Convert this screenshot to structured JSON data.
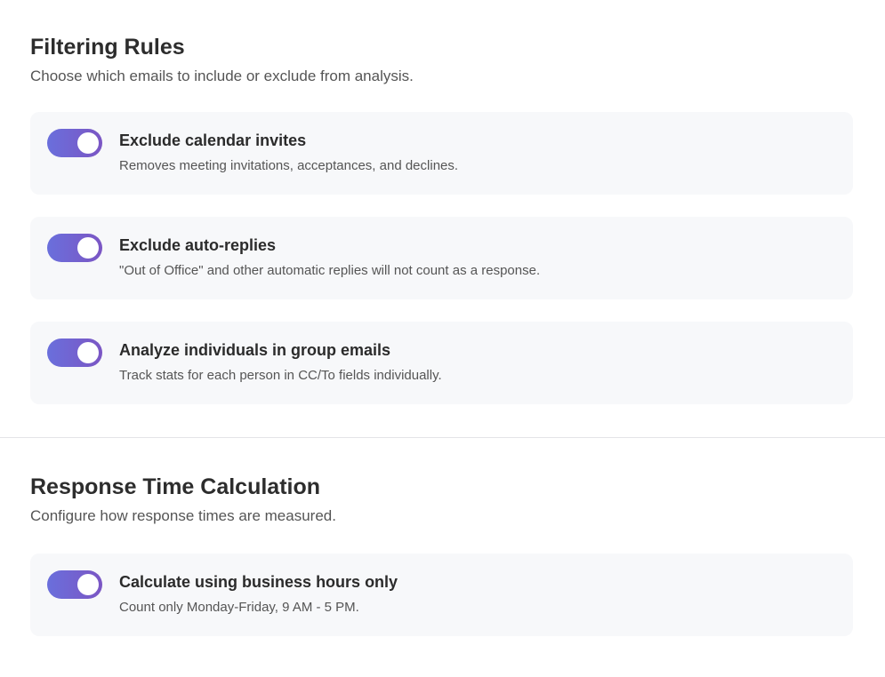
{
  "filtering": {
    "title": "Filtering Rules",
    "description": "Choose which emails to include or exclude from analysis.",
    "rules": [
      {
        "title": "Exclude calendar invites",
        "description": "Removes meeting invitations, acceptances, and declines.",
        "enabled": true
      },
      {
        "title": "Exclude auto-replies",
        "description": "\"Out of Office\" and other automatic replies will not count as a response.",
        "enabled": true
      },
      {
        "title": "Analyze individuals in group emails",
        "description": "Track stats for each person in CC/To fields individually.",
        "enabled": true
      }
    ]
  },
  "response_time": {
    "title": "Response Time Calculation",
    "description": "Configure how response times are measured.",
    "rules": [
      {
        "title": "Calculate using business hours only",
        "description": "Count only Monday-Friday, 9 AM - 5 PM.",
        "enabled": true
      }
    ]
  },
  "colors": {
    "toggle_on_start": "#6a6fdc",
    "toggle_on_end": "#7b56c4",
    "card_background": "#f7f8fa"
  }
}
